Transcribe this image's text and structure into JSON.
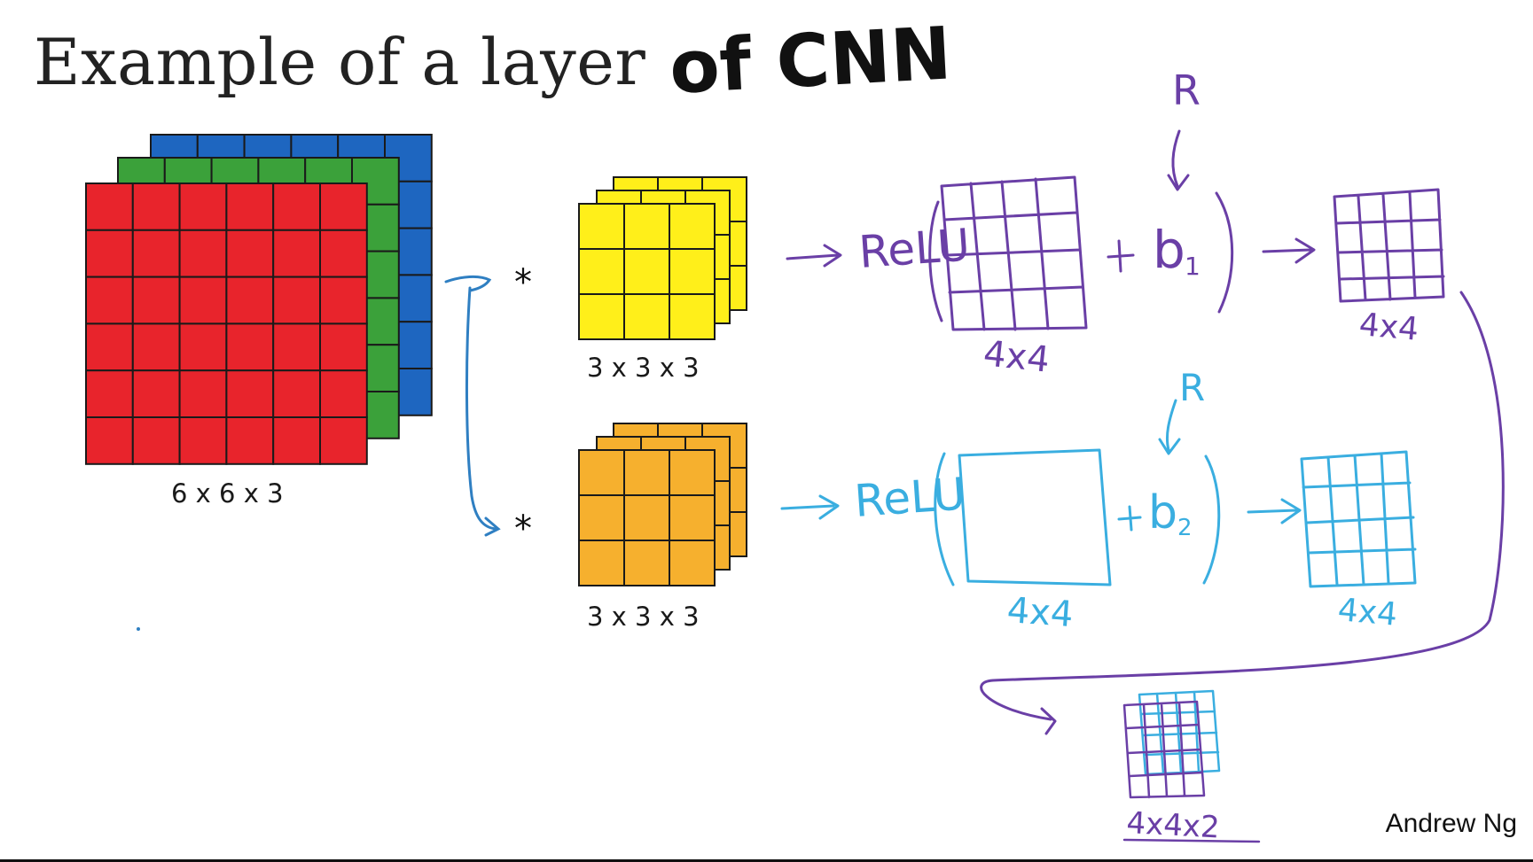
{
  "slide": {
    "title_printed": "Example of a layer",
    "title_handwritten": "of CNN",
    "credit": "Andrew Ng"
  },
  "input": {
    "label": "6 x 6 x 3",
    "channel_colors": [
      "#e8242c",
      "#3ba13a",
      "#1e66c0"
    ]
  },
  "filters": [
    {
      "label": "3 x 3 x 3",
      "color": "#ffef1a",
      "operator": "*"
    },
    {
      "label": "3 x 3 x 3",
      "color": "#f6b02e",
      "operator": "*"
    }
  ],
  "branches": [
    {
      "activation": "ReLU",
      "bias": "b",
      "bias_subscript": "1",
      "conv_output_label": "4x4",
      "output_label": "4x4",
      "broadcast_symbol": "R",
      "ink": "#6a3fa6"
    },
    {
      "activation": "ReLU",
      "bias": "b",
      "bias_subscript": "2",
      "conv_output_label": "4x4",
      "output_label": "4x4",
      "broadcast_symbol": "R",
      "ink": "#3aaee0"
    }
  ],
  "stacked_output": {
    "label": "4x4x2"
  },
  "colors": {
    "ink_purple": "#6a3fa6",
    "ink_blue": "#3aaee0",
    "ink_black": "#111111"
  }
}
